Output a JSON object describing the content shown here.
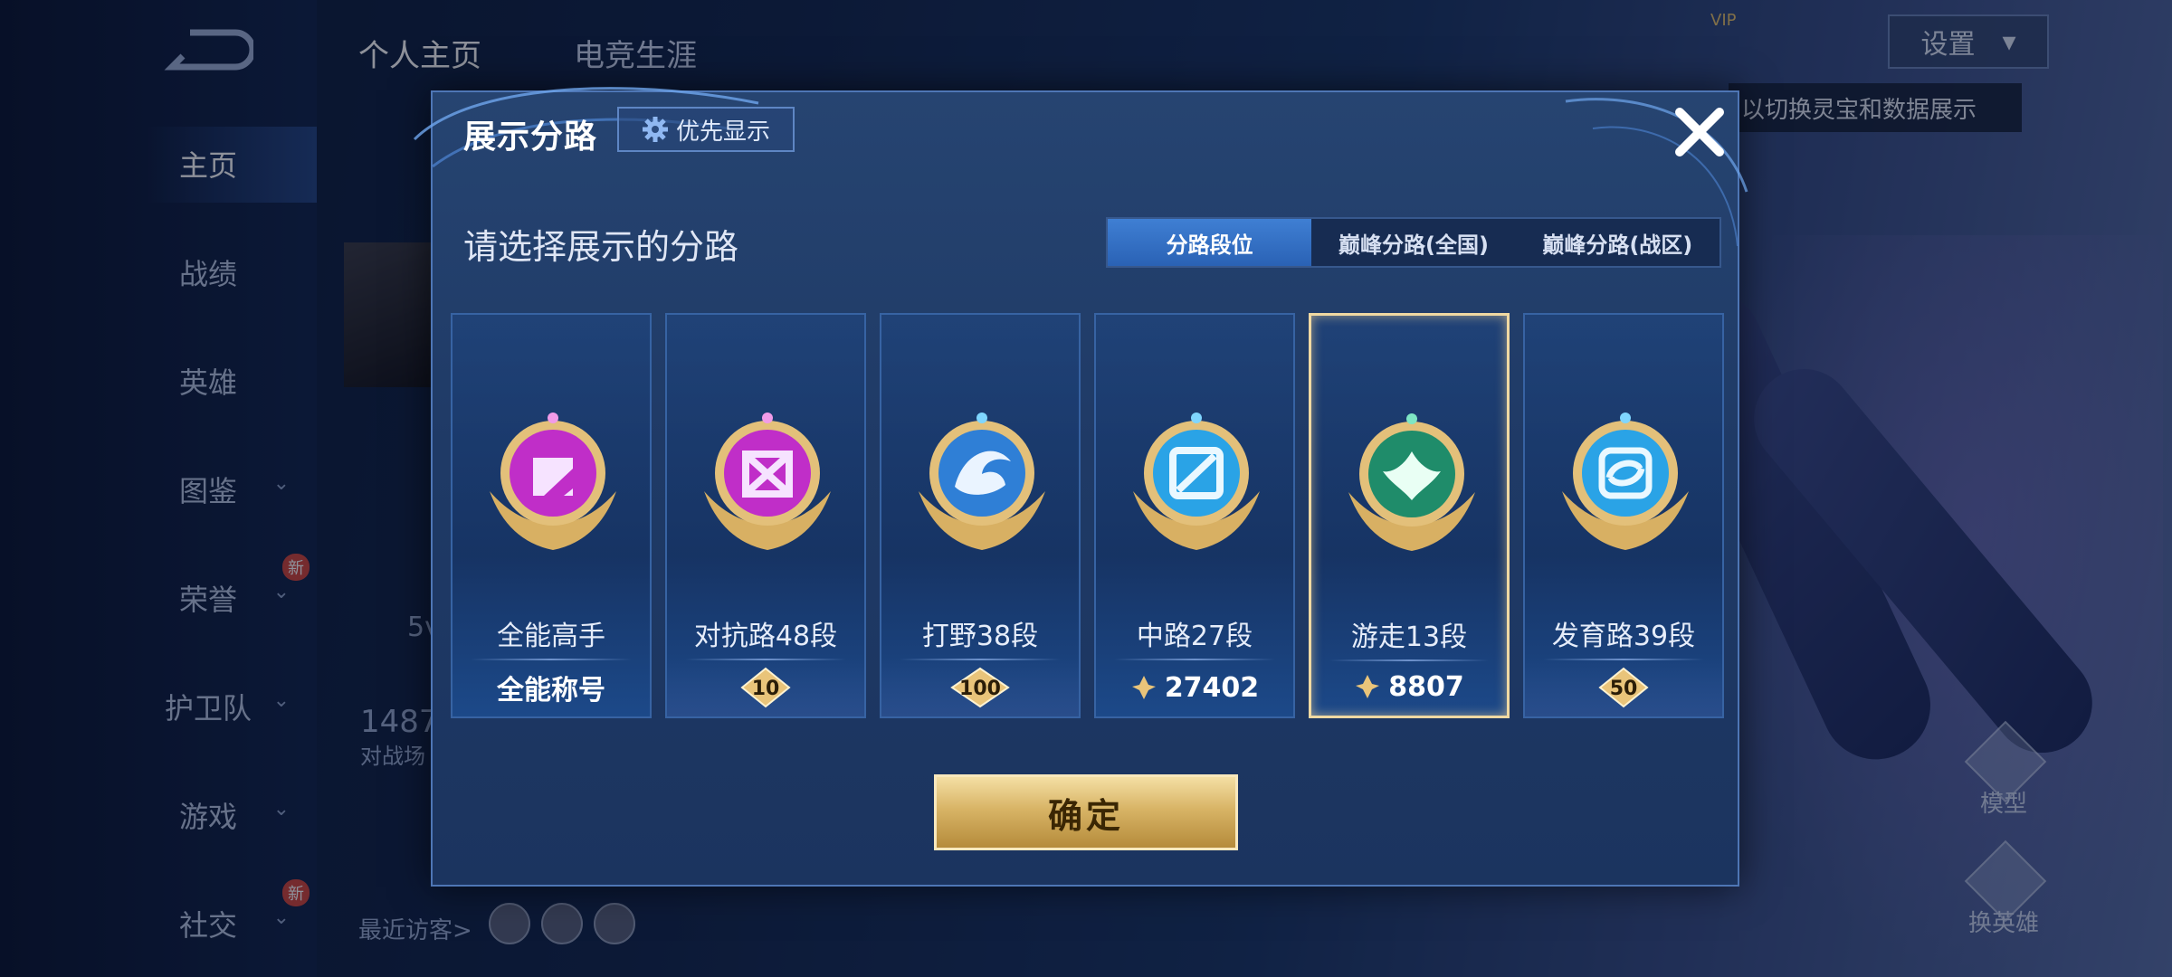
{
  "background": {
    "top_tabs": [
      "个人主页",
      "电竞生涯"
    ],
    "nav": [
      {
        "label": "主页",
        "chevron": false,
        "new": false
      },
      {
        "label": "战绩",
        "chevron": false,
        "new": false
      },
      {
        "label": "英雄",
        "chevron": false,
        "new": false
      },
      {
        "label": "图鉴",
        "chevron": true,
        "new": false
      },
      {
        "label": "荣誉",
        "chevron": true,
        "new": true
      },
      {
        "label": "护卫队",
        "chevron": true,
        "new": false
      },
      {
        "label": "游戏",
        "chevron": true,
        "new": false
      },
      {
        "label": "社交",
        "chevron": true,
        "new": true
      }
    ],
    "new_badge": "新",
    "settings_label": "设置",
    "tip_text": "以切换灵宝和数据展示",
    "vip_label": "VIP",
    "stat_partial": "1487",
    "stat_sub_partial": "对战场",
    "level_partial": "5v",
    "recent_visitors_label": "最近访客>",
    "model_label": "模型",
    "switch_hero_label": "换英雄"
  },
  "dialog": {
    "title": "展示分路",
    "priority_label": "优先显示",
    "subtitle": "请选择展示的分路",
    "segments": [
      {
        "label": "分路段位",
        "active": true
      },
      {
        "label": "巅峰分路(全国)",
        "active": false
      },
      {
        "label": "巅峰分路(战区)",
        "active": false
      }
    ],
    "cards": [
      {
        "name": "全能高手",
        "footer_type": "text",
        "footer": "全能称号",
        "emblem_color": "#c02ec8",
        "selected": false
      },
      {
        "name": "对抗路48段",
        "footer_type": "badge",
        "footer": "10",
        "emblem_color": "#c02ec8",
        "selected": false
      },
      {
        "name": "打野38段",
        "footer_type": "badge",
        "footer": "100",
        "emblem_color": "#2f7fd6",
        "selected": false
      },
      {
        "name": "中路27段",
        "footer_type": "points",
        "footer": "27402",
        "emblem_color": "#2aa3e6",
        "selected": false
      },
      {
        "name": "游走13段",
        "footer_type": "points",
        "footer": "8807",
        "emblem_color": "#1f8c6a",
        "selected": true
      },
      {
        "name": "发育路39段",
        "footer_type": "badge",
        "footer": "50",
        "emblem_color": "#2aa3e6",
        "selected": false
      }
    ],
    "confirm_label": "确定"
  }
}
